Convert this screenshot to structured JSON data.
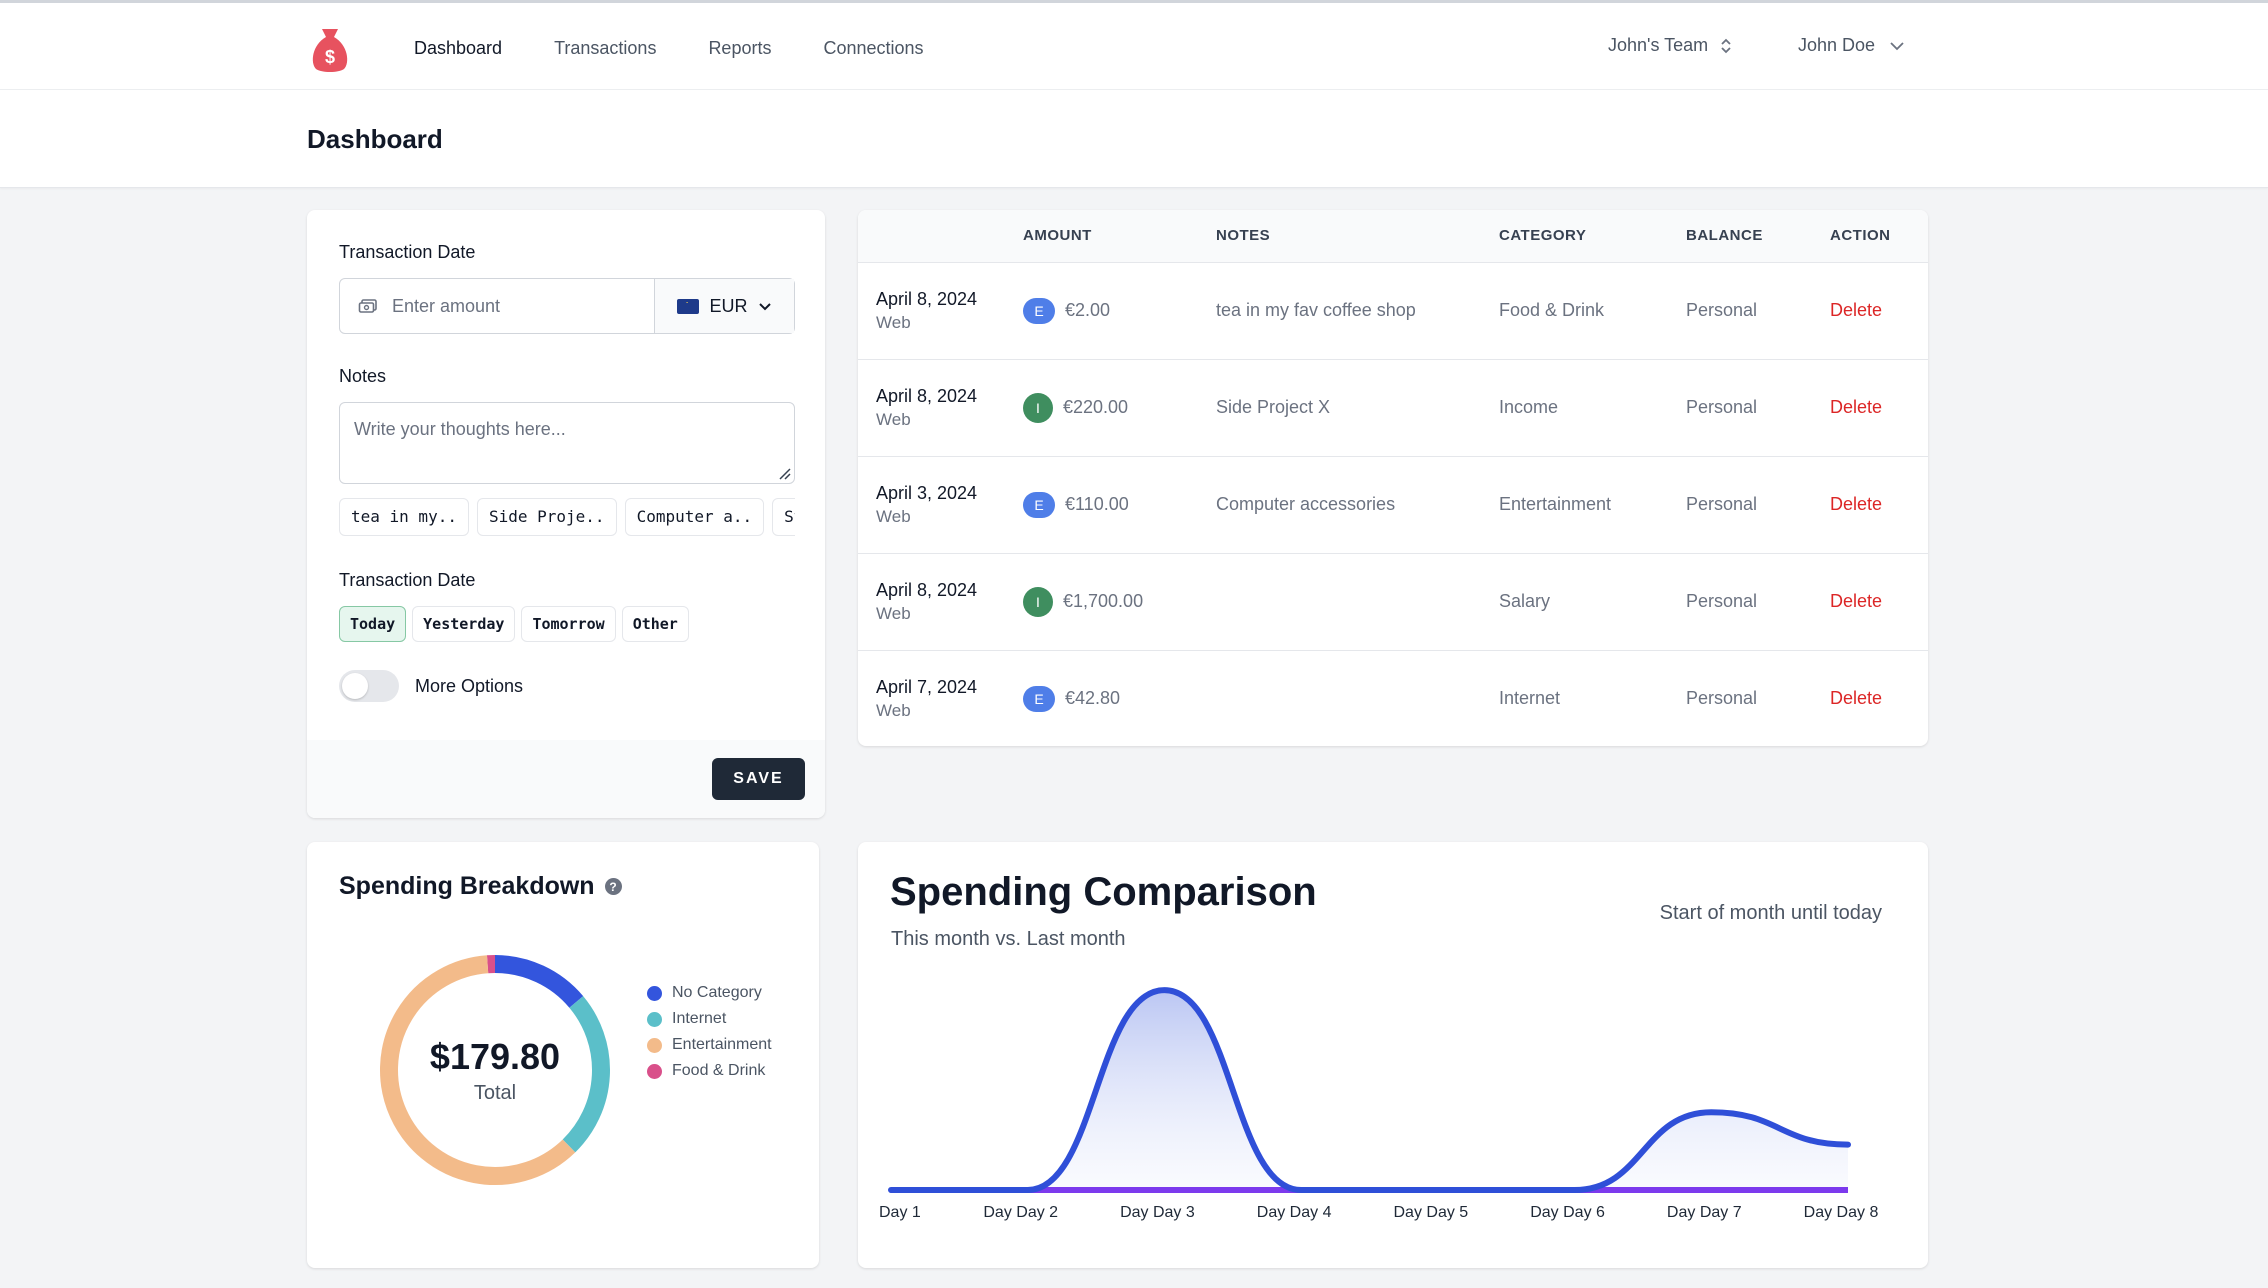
{
  "nav": {
    "items": [
      {
        "label": "Dashboard",
        "active": true
      },
      {
        "label": "Transactions",
        "active": false
      },
      {
        "label": "Reports",
        "active": false
      },
      {
        "label": "Connections",
        "active": false
      }
    ],
    "team": "John's Team",
    "user": "John Doe",
    "logo_icon": "money-bag-icon",
    "accent_color": "#e7525f"
  },
  "page": {
    "title": "Dashboard"
  },
  "form": {
    "amount_label": "Transaction Date",
    "amount_placeholder": "Enter amount",
    "currency": "EUR",
    "notes_label": "Notes",
    "notes_placeholder": "Write your thoughts here...",
    "note_suggestions": [
      "tea in my..",
      "Side Proje..",
      "Computer a..",
      "St"
    ],
    "date_label": "Transaction Date",
    "date_options": [
      "Today",
      "Yesterday",
      "Tomorrow",
      "Other"
    ],
    "selected_date": "Today",
    "more_options_label": "More Options",
    "more_options_on": false,
    "save_label": "SAVE"
  },
  "table": {
    "headers": [
      "",
      "AMOUNT",
      "NOTES",
      "CATEGORY",
      "BALANCE",
      "ACTION"
    ],
    "rows": [
      {
        "date": "April 8, 2024",
        "source": "Web",
        "type": "E",
        "amount": "€2.00",
        "notes": "tea in my fav coffee shop",
        "category": "Food & Drink",
        "balance": "Personal",
        "action": "Delete"
      },
      {
        "date": "April 8, 2024",
        "source": "Web",
        "type": "I",
        "amount": "€220.00",
        "notes": "Side Project X",
        "category": "Income",
        "balance": "Personal",
        "action": "Delete"
      },
      {
        "date": "April 3, 2024",
        "source": "Web",
        "type": "E",
        "amount": "€110.00",
        "notes": "Computer accessories",
        "category": "Entertainment",
        "balance": "Personal",
        "action": "Delete"
      },
      {
        "date": "April 8, 2024",
        "source": "Web",
        "type": "I",
        "amount": "€1,700.00",
        "notes": "",
        "category": "Salary",
        "balance": "Personal",
        "action": "Delete"
      },
      {
        "date": "April 7, 2024",
        "source": "Web",
        "type": "E",
        "amount": "€42.80",
        "notes": "",
        "category": "Internet",
        "balance": "Personal",
        "action": "Delete"
      }
    ]
  },
  "breakdown": {
    "title": "Spending Breakdown",
    "total": "$179.80",
    "total_label": "Total",
    "segments": [
      {
        "name": "No Category",
        "value": 25,
        "color": "#3355dd"
      },
      {
        "name": "Internet",
        "value": 42.8,
        "color": "#5bbfc9"
      },
      {
        "name": "Entertainment",
        "value": 110,
        "color": "#f3bb8a"
      },
      {
        "name": "Food & Drink",
        "value": 2,
        "color": "#d9508a"
      }
    ]
  },
  "comparison": {
    "title": "Spending Comparison",
    "subtitle": "This month vs. Last month",
    "range_label": "Start of month until today"
  },
  "chart_data": {
    "type": "area",
    "title": "Spending Comparison",
    "subtitle": "This month vs. Last month",
    "categories": [
      "Day 1",
      "Day Day 2",
      "Day Day 3",
      "Day Day 4",
      "Day Day 5",
      "Day Day 6",
      "Day Day 7",
      "Day Day 8"
    ],
    "series": [
      {
        "name": "This month",
        "color": "#2f4fd8",
        "values": [
          0,
          0,
          110,
          0,
          0,
          0,
          42.8,
          25
        ]
      },
      {
        "name": "Last month",
        "color": "#7c3aed",
        "values": [
          0,
          0,
          0,
          0,
          0,
          0,
          0,
          0
        ]
      }
    ],
    "ylim": [
      0,
      120
    ],
    "grid": false,
    "legend": "none"
  }
}
